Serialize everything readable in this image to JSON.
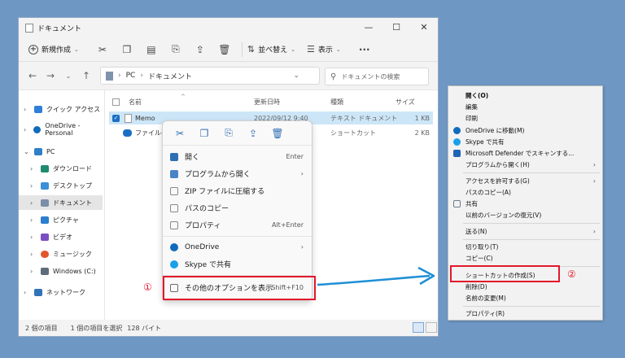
{
  "window": {
    "title": "ドキュメント",
    "controls": [
      "—",
      "☐",
      "✕"
    ]
  },
  "toolbar": {
    "new_label": "新規作成",
    "sort_label": "並べ替え",
    "view_label": "表示",
    "more": "···"
  },
  "address": {
    "path": [
      "PC",
      "ドキュメント"
    ],
    "search_placeholder": "ドキュメントの検索"
  },
  "nav": {
    "items": [
      {
        "label": "クイック アクセス",
        "icon": "star-icon",
        "color": "#2f7fd6"
      },
      {
        "label": "OneDrive - Personal",
        "icon": "cloud-icon",
        "color": "#0f6cbd"
      },
      {
        "label": "PC",
        "icon": "monitor-icon",
        "color": "#2c7fc8"
      },
      {
        "label": "ダウンロード",
        "icon": "download-icon",
        "color": "#1f8a6c"
      },
      {
        "label": "デスクトップ",
        "icon": "desktop-icon",
        "color": "#3a8fd8"
      },
      {
        "label": "ドキュメント",
        "icon": "document-icon",
        "color": "#7c8ea7"
      },
      {
        "label": "ピクチャ",
        "icon": "picture-icon",
        "color": "#2a7fcf"
      },
      {
        "label": "ビデオ",
        "icon": "video-icon",
        "color": "#7a4fc4"
      },
      {
        "label": "ミュージック",
        "icon": "music-icon",
        "color": "#e2562b"
      },
      {
        "label": "Windows (C:)",
        "icon": "drive-icon",
        "color": "#5f6c7b"
      },
      {
        "label": "ネットワーク",
        "icon": "network-icon",
        "color": "#3173b8"
      }
    ]
  },
  "columns": {
    "name": "名前",
    "modified": "更新日時",
    "type": "種類",
    "size": "サイズ"
  },
  "files": [
    {
      "name": "Memo",
      "modified": "2022/09/12 9:40",
      "type": "テキスト ドキュメント",
      "size": "1 KB"
    },
    {
      "name": "ファイルの場",
      "modified": "",
      "type": "ショートカット",
      "size": "2 KB"
    }
  ],
  "status": {
    "count": "2 個の項目",
    "selected": "1 個の項目を選択",
    "bytes": "128 バイト"
  },
  "context_menu": {
    "items": [
      {
        "label": "開く",
        "shortcut": "Enter",
        "icon": "open-icon",
        "color": "#2c6fb5"
      },
      {
        "label": "プログラムから開く",
        "shortcut": "›",
        "icon": "open-with-icon",
        "color": "#4a84c4"
      },
      {
        "label": "ZIP ファイルに圧縮する",
        "shortcut": "",
        "icon": "zip-icon",
        "color": "#8a8a8a"
      },
      {
        "label": "パスのコピー",
        "shortcut": "",
        "icon": "copy-path-icon",
        "color": "#8a8a8a"
      },
      {
        "label": "プロパティ",
        "shortcut": "Alt+Enter",
        "icon": "properties-icon",
        "color": "#8a8a8a"
      },
      {
        "label": "OneDrive",
        "shortcut": "›",
        "icon": "onedrive-icon",
        "color": "#0f6cbd"
      },
      {
        "label": "Skype で共有",
        "shortcut": "",
        "icon": "skype-icon",
        "color": "#1aa0e8"
      },
      {
        "label": "その他のオプションを表示",
        "shortcut": "Shift+F10",
        "icon": "more-options-icon",
        "color": "#6b6b6b"
      }
    ]
  },
  "classic_menu": {
    "items": [
      {
        "label": "開く(O)",
        "bold": true
      },
      {
        "label": "編集"
      },
      {
        "label": "印刷"
      },
      {
        "label": "OneDrive に移動(M)",
        "icon_color": "#0f6cbd"
      },
      {
        "label": "Skype で共有",
        "icon_color": "#1aa0e8"
      },
      {
        "label": "Microsoft Defender でスキャンする...",
        "icon_color": "#1e63b5"
      },
      {
        "label": "プログラムから開く(H)",
        "arrow": true
      },
      {
        "label": "アクセスを許可する(G)",
        "arrow": true
      },
      {
        "label": "パスのコピー(A)"
      },
      {
        "label": "共有",
        "icon_color": "#6d7c8e"
      },
      {
        "label": "以前のバージョンの復元(V)"
      },
      {
        "label": "送る(N)",
        "arrow": true
      },
      {
        "label": "切り取り(T)"
      },
      {
        "label": "コピー(C)"
      },
      {
        "label": "ショートカットの作成(S)"
      },
      {
        "label": "削除(D)"
      },
      {
        "label": "名前の変更(M)"
      },
      {
        "label": "プロパティ(R)"
      }
    ]
  },
  "annotations": {
    "one": "①",
    "two": "②",
    "arrow_color": "#1f8fd6",
    "highlight_color": "#e2182b"
  }
}
